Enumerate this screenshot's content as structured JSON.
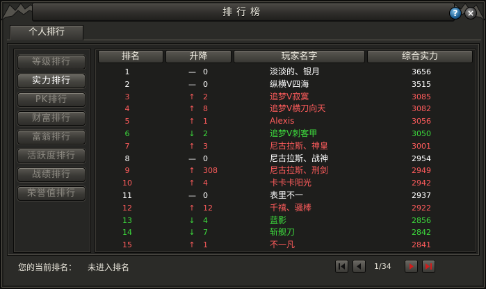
{
  "window": {
    "title": "排行榜",
    "help_label": "?",
    "close_label": "×"
  },
  "tabs": [
    {
      "label": "个人排行"
    }
  ],
  "sidebar": {
    "items": [
      {
        "label": "等级排行"
      },
      {
        "label": "实力排行"
      },
      {
        "label": "PK排行"
      },
      {
        "label": "财富排行"
      },
      {
        "label": "富翁排行"
      },
      {
        "label": "活跃度排行"
      },
      {
        "label": "战绩排行"
      },
      {
        "label": "荣誉值排行"
      }
    ],
    "active_index": 1
  },
  "table": {
    "headers": {
      "rank": "排名",
      "change": "升降",
      "name": "玩家名字",
      "power": "综合实力"
    },
    "rows": [
      {
        "rank": "1",
        "arrow": "—",
        "change": "0",
        "name": "淡淡的、银月",
        "power": "3656",
        "color": "#ffffff"
      },
      {
        "rank": "2",
        "arrow": "—",
        "change": "0",
        "name": "纵横V四海",
        "power": "3515",
        "color": "#ffffff"
      },
      {
        "rank": "3",
        "arrow": "↑",
        "change": "2",
        "name": "追梦V寂寞",
        "power": "3085",
        "color": "#ff5c5c"
      },
      {
        "rank": "4",
        "arrow": "↑",
        "change": "8",
        "name": "追梦V横刀向天",
        "power": "3082",
        "color": "#ff5c5c"
      },
      {
        "rank": "5",
        "arrow": "↑",
        "change": "1",
        "name": "Alexis",
        "power": "3056",
        "color": "#ff5c5c"
      },
      {
        "rank": "6",
        "arrow": "↓",
        "change": "2",
        "name": "追梦V刺客甲",
        "power": "3050",
        "color": "#3ddc3d"
      },
      {
        "rank": "7",
        "arrow": "↑",
        "change": "3",
        "name": "尼古拉斯、神皇",
        "power": "3001",
        "color": "#ff5c5c"
      },
      {
        "rank": "8",
        "arrow": "—",
        "change": "0",
        "name": "尼古拉斯、战神",
        "power": "2954",
        "color": "#ffffff"
      },
      {
        "rank": "9",
        "arrow": "↑",
        "change": "308",
        "name": "尼古拉斯、刑剑",
        "power": "2949",
        "color": "#ff5c5c"
      },
      {
        "rank": "10",
        "arrow": "↑",
        "change": "4",
        "name": "卡卡卡阳光",
        "power": "2942",
        "color": "#ff5c5c"
      },
      {
        "rank": "11",
        "arrow": "—",
        "change": "0",
        "name": "表里不一",
        "power": "2937",
        "color": "#ffffff"
      },
      {
        "rank": "12",
        "arrow": "↑",
        "change": "12",
        "name": "千禧、骚棒",
        "power": "2922",
        "color": "#ff5c5c"
      },
      {
        "rank": "13",
        "arrow": "↓",
        "change": "4",
        "name": "蓝影",
        "power": "2856",
        "color": "#3ddc3d"
      },
      {
        "rank": "14",
        "arrow": "↓",
        "change": "7",
        "name": "斩舰刀",
        "power": "2842",
        "color": "#3ddc3d"
      },
      {
        "rank": "15",
        "arrow": "↑",
        "change": "1",
        "name": "不一凡",
        "power": "2841",
        "color": "#ff5c5c"
      }
    ]
  },
  "footer": {
    "current_rank_label": "您的当前排名：",
    "current_rank_value": "未进入排名",
    "page": "1/34",
    "first_icon": "first-page-icon",
    "prev_icon": "prev-page-icon",
    "next_icon": "next-page-icon",
    "last_icon": "last-page-icon"
  }
}
